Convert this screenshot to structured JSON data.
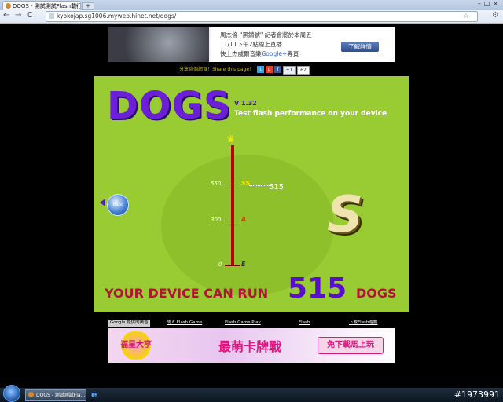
{
  "browser": {
    "tab_title": "DOGS - 測試測試Flash載行",
    "tab_close": "×",
    "new_tab": "+",
    "window_controls": "–□×",
    "url": "kyokojap.sg1006.myweb.hinet.net/dogs/",
    "back_icon": "←",
    "forward_icon": "→",
    "reload_icon": "C",
    "star_icon": "☆",
    "wrench_icon": "⚙"
  },
  "ad_top": {
    "line1": "周杰倫 \"黑鑽號\" 記者會將於本周五",
    "line2": "11/11下午2點線上直播",
    "line3_pre": "快上杰威爾音樂",
    "line3_google": "Google+",
    "line3_post": "專頁",
    "button": "了解詳情"
  },
  "share": {
    "label": "分享這個網頁！Share this page！",
    "plus_one": "+1",
    "count": "62"
  },
  "game": {
    "title": "DOGS",
    "version": "V 1.32",
    "tagline": "Test flash performance on your device",
    "back_label": "Back",
    "gauge": {
      "labels": [
        "550",
        "300",
        "0"
      ],
      "grades": [
        "SS",
        "A",
        "E"
      ],
      "score_pointer": "515"
    },
    "grade": "S",
    "result_pre": "YOUR DEVICE CAN RUN",
    "result_value": "515",
    "result_post": "DOGS"
  },
  "links": {
    "google_label": "Google 提供的廣告",
    "items": [
      "成人 Flash Game",
      "Flash Game Play",
      "Flash",
      "下載Flash遊戲"
    ]
  },
  "ad_bottom": {
    "logo": "福星大亨",
    "title": "最萌卡牌戰",
    "button": "免下載馬上玩"
  },
  "taskbar": {
    "item": "DOGS - 測試測試Fla...",
    "tray": "#1973991"
  }
}
